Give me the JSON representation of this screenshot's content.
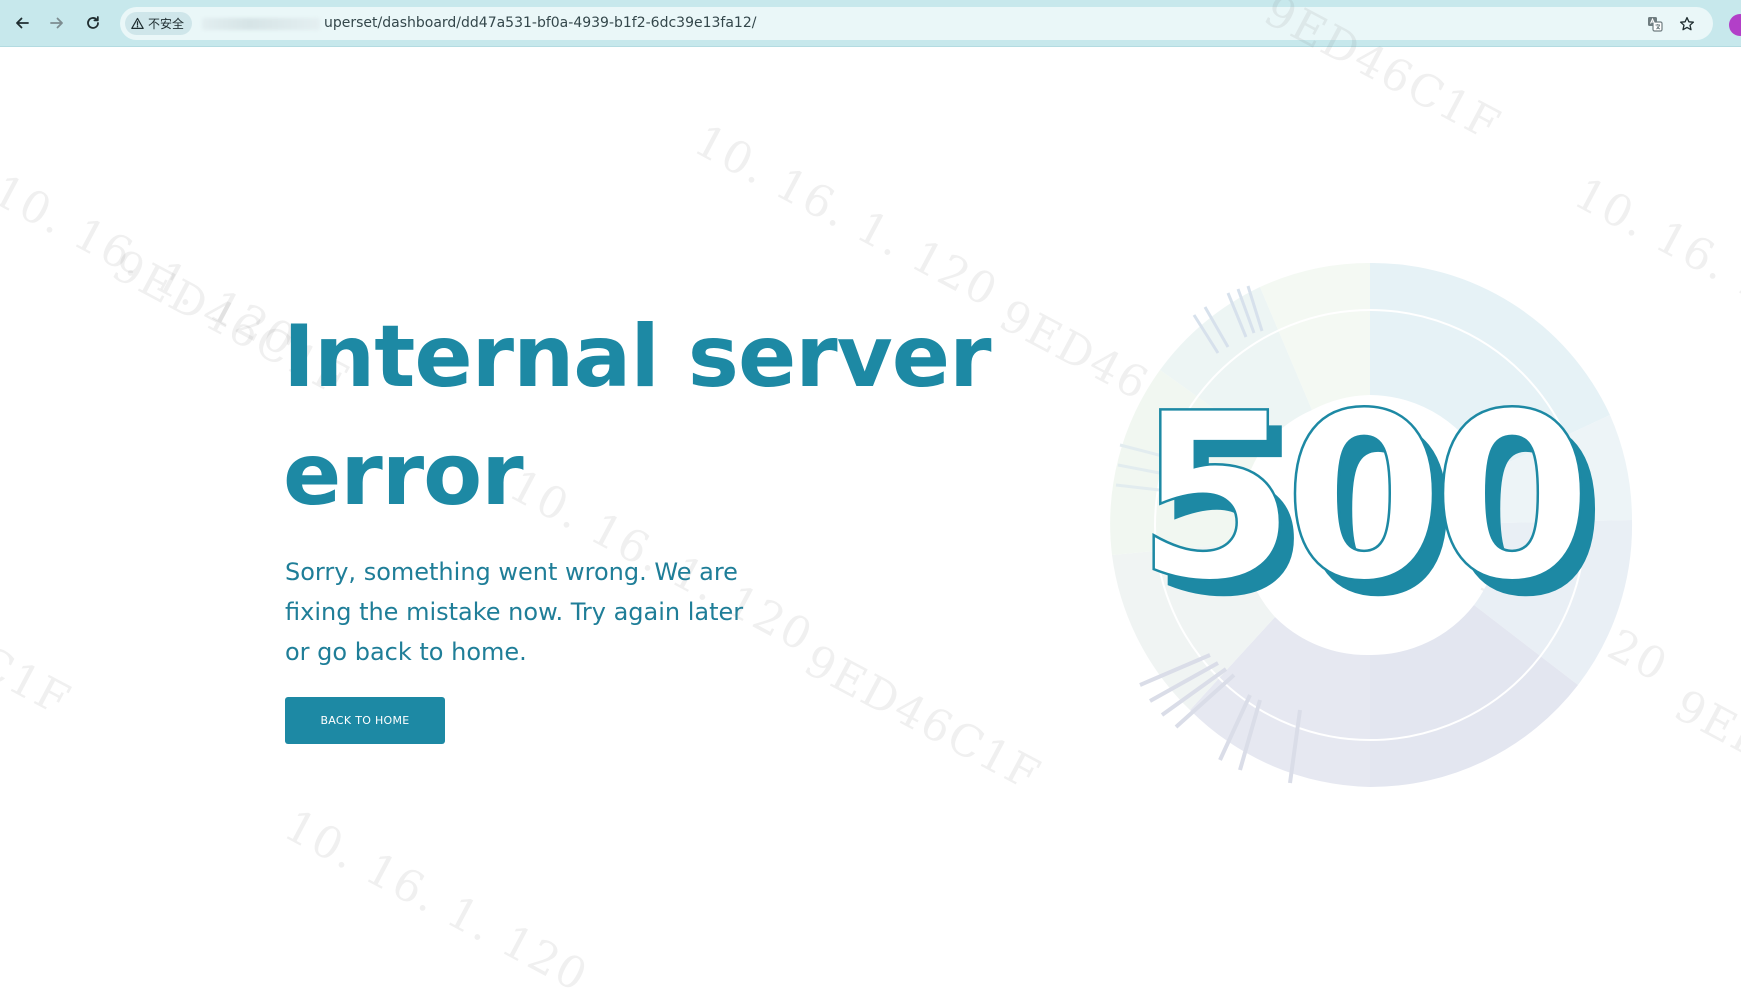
{
  "browser": {
    "security_label": "不安全",
    "url": "uperset/dashboard/dd47a531-bf0a-4939-b1f2-6dc39e13fa12/",
    "icons": [
      "back-arrow-icon",
      "forward-arrow-icon",
      "reload-icon",
      "warning-triangle-icon",
      "translate-icon",
      "star-icon"
    ]
  },
  "watermark": {
    "ip": "10. 16. 1. 120",
    "code": "9ED46C1F"
  },
  "error": {
    "title": "Internal server error",
    "message": "Sorry, something went wrong. We are fixing the mistake now. Try again later or go back to home.",
    "button_label": "BACK TO HOME",
    "code": "500"
  },
  "colors": {
    "accent": "#1d89a4",
    "chrome": "#c7e8ec"
  }
}
